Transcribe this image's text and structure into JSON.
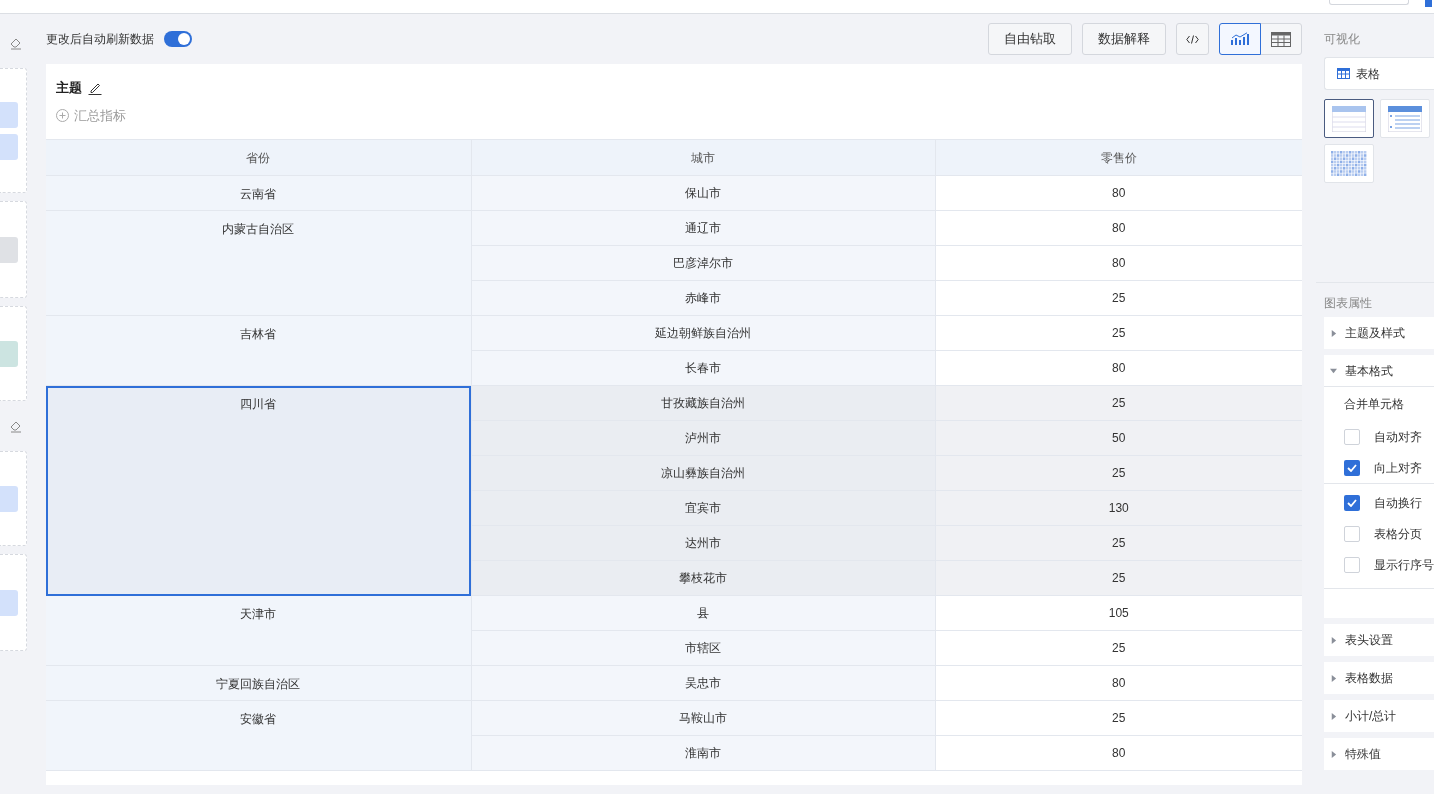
{
  "toolbar": {
    "auto_refresh": {
      "label": "更改后自动刷新数据",
      "on": true
    },
    "buttons": [
      "自由钻取",
      "数据解释"
    ],
    "view_toggle": [
      {
        "kind": "chart",
        "selected": true
      },
      {
        "kind": "table",
        "selected": false
      }
    ]
  },
  "card": {
    "title": "主题",
    "add_metric": "汇总指标"
  },
  "table": {
    "columns": [
      "省份",
      "城市",
      "零售价"
    ],
    "groups": [
      {
        "province": "云南省",
        "selected": false,
        "rows": [
          {
            "city": "保山市",
            "price": "80"
          }
        ]
      },
      {
        "province": "内蒙古自治区",
        "selected": false,
        "rows": [
          {
            "city": "通辽市",
            "price": "80"
          },
          {
            "city": "巴彦淖尔市",
            "price": "80"
          },
          {
            "city": "赤峰市",
            "price": "25"
          }
        ]
      },
      {
        "province": "吉林省",
        "selected": false,
        "rows": [
          {
            "city": "延边朝鲜族自治州",
            "price": "25"
          },
          {
            "city": "长春市",
            "price": "80"
          }
        ]
      },
      {
        "province": "四川省",
        "selected": true,
        "rows": [
          {
            "city": "甘孜藏族自治州",
            "price": "25"
          },
          {
            "city": "泸州市",
            "price": "50"
          },
          {
            "city": "凉山彝族自治州",
            "price": "25"
          },
          {
            "city": "宜宾市",
            "price": "130"
          },
          {
            "city": "达州市",
            "price": "25"
          },
          {
            "city": "攀枝花市",
            "price": "25"
          }
        ]
      },
      {
        "province": "天津市",
        "selected": false,
        "rows": [
          {
            "city": "县",
            "price": "105"
          },
          {
            "city": "市辖区",
            "price": "25"
          }
        ]
      },
      {
        "province": "宁夏回族自治区",
        "selected": false,
        "rows": [
          {
            "city": "吴忠市",
            "price": "80"
          }
        ]
      },
      {
        "province": "安徽省",
        "selected": false,
        "rows": [
          {
            "city": "马鞍山市",
            "price": "25"
          },
          {
            "city": "淮南市",
            "price": "80"
          }
        ]
      }
    ]
  },
  "side_panel": {
    "visualization_title": "可视化",
    "chart_type": "表格",
    "thumbnails": [
      {
        "kind": "plain",
        "selected": true
      },
      {
        "kind": "list",
        "selected": false
      },
      {
        "kind": "grid",
        "selected": false
      }
    ],
    "properties_title": "图表属性",
    "sections": [
      {
        "title": "主题及样式",
        "expanded": false
      },
      {
        "title": "基本格式",
        "expanded": true,
        "subtitle": "合并单元格",
        "options": [
          {
            "label": "自动对齐",
            "checked": false
          },
          {
            "label": "向上对齐",
            "checked": true
          }
        ],
        "more_options": [
          {
            "label": "自动换行",
            "checked": true
          },
          {
            "label": "表格分页",
            "checked": false
          },
          {
            "label": "显示行序号",
            "checked": false
          }
        ]
      },
      {
        "title": "表头设置",
        "expanded": false
      },
      {
        "title": "表格数据",
        "expanded": false
      },
      {
        "title": "小计/总计",
        "expanded": false
      },
      {
        "title": "特殊值",
        "expanded": false
      }
    ]
  }
}
